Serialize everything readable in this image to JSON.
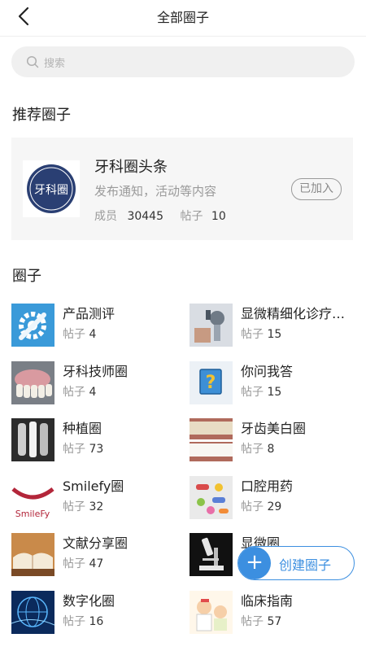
{
  "header": {
    "title": "全部圈子"
  },
  "search": {
    "placeholder": "搜索"
  },
  "recommended": {
    "section_title": "推荐圈子",
    "name": "牙科圈头条",
    "description": "发布通知，活动等内容",
    "members_label": "成员",
    "members": "30445",
    "posts_label": "帖子",
    "posts": "10",
    "status": "已加入",
    "logo_text": "牙科圈"
  },
  "circles_section_title": "圈子",
  "posts_label": "帖子",
  "circles": [
    {
      "name": "产品测评",
      "posts": "4",
      "icon": "wrench-gear-icon"
    },
    {
      "name": "显微精细化诊疗…",
      "posts": "15",
      "icon": "microscope-photo"
    },
    {
      "name": "牙科技师圈",
      "posts": "4",
      "icon": "denture-photo"
    },
    {
      "name": "你问我答",
      "posts": "15",
      "icon": "question-mark-icon"
    },
    {
      "name": "种植圈",
      "posts": "73",
      "icon": "xray-photo"
    },
    {
      "name": "牙齿美白圈",
      "posts": "8",
      "icon": "teeth-photo"
    },
    {
      "name": "Smilefy圈",
      "posts": "32",
      "icon": "smilefy-logo",
      "logo_text": "SmileFy"
    },
    {
      "name": "口腔用药",
      "posts": "29",
      "icon": "pills-photo"
    },
    {
      "name": "文献分享圈",
      "posts": "47",
      "icon": "book-photo"
    },
    {
      "name": "显微圈",
      "posts": "",
      "icon": "microscope-icon"
    },
    {
      "name": "数字化圈",
      "posts": "16",
      "icon": "digital-globe-photo"
    },
    {
      "name": "临床指南",
      "posts": "57",
      "icon": "doctor-cartoon"
    }
  ],
  "fab": {
    "label": "创建圈子"
  },
  "colors": {
    "accent": "#3c8fe0",
    "card_bg": "#f6f6f6",
    "logo_blue": "#2a3f73"
  }
}
